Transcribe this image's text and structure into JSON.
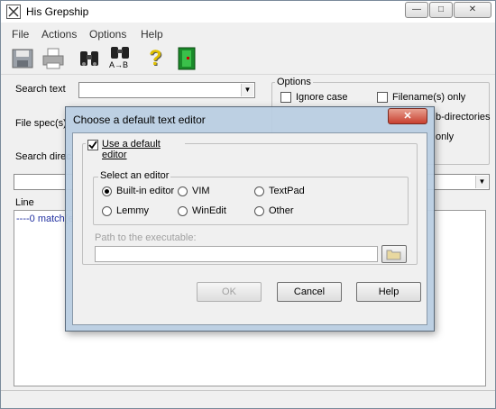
{
  "window": {
    "title": "His Grepship"
  },
  "window_controls": {
    "minimize": "—",
    "maximize": "□",
    "close": "✕"
  },
  "menu": [
    "File",
    "Actions",
    "Options",
    "Help"
  ],
  "toolbar": {
    "save_icon": "save-icon",
    "print_icon": "print-icon",
    "find_icon": "binoculars-icon",
    "replace_icon": "binoculars-replace-icon",
    "replace_label": "A→B",
    "help_icon": "question-icon",
    "help_glyph": "?",
    "exit_icon": "exit-door-icon"
  },
  "form": {
    "search_text_label": "Search text",
    "file_spec_label": "File spec(s)",
    "search_directory_label": "Search direc",
    "search_text_value": "",
    "search_directory_value": ""
  },
  "options": {
    "title": "Options",
    "ignore_case": "Ignore case",
    "filenames_only": "Filename(s) only",
    "sub_directories_partial": "b-directories",
    "only_partial": "only"
  },
  "results": {
    "column_line": "Line",
    "row_0": "----0 match(e"
  },
  "dialog": {
    "title": "Choose a default text editor",
    "close_label": "✕",
    "use_default_editor": "Use a default editor",
    "use_default_checked": true,
    "select_editor_label": "Select an editor",
    "editors": [
      "Built-in editor",
      "VIM",
      "TextPad",
      "Lemmy",
      "WinEdit",
      "Other"
    ],
    "selected_editor": "Built-in editor",
    "path_label": "Path to the executable:",
    "path_value": "",
    "ok_label": "OK",
    "cancel_label": "Cancel",
    "help_label": "Help"
  }
}
